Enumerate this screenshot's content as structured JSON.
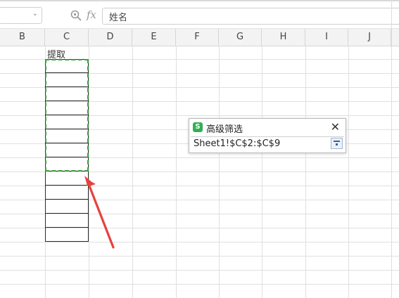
{
  "formula_bar": {
    "name_box_value": "",
    "fx_label": "fx",
    "formula_value": "姓名"
  },
  "columns": [
    "B",
    "C",
    "D",
    "E",
    "F",
    "G",
    "H",
    "I",
    "J"
  ],
  "cells": {
    "c1_value": "提取"
  },
  "dialog": {
    "logo_letter": "S",
    "title": "高级筛选",
    "close_symbol": "✕",
    "range_value": "Sheet1!$C$2:$C$9"
  },
  "colors": {
    "marquee": "#39a13c",
    "arrow": "#e8413d",
    "logo_green": "#30b055"
  }
}
